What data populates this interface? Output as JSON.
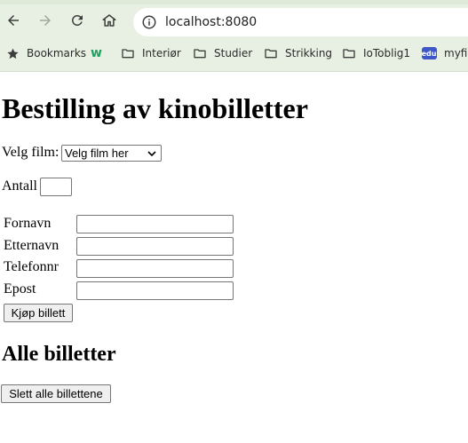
{
  "browser": {
    "url": "localhost:8080",
    "bookmarks": [
      {
        "label": "Bookmarks",
        "icon": "star-icon"
      },
      {
        "label": "",
        "icon": "w-logo-icon"
      },
      {
        "label": "Interiør",
        "icon": "folder-icon"
      },
      {
        "label": "Studier",
        "icon": "folder-icon"
      },
      {
        "label": "Strikking",
        "icon": "folder-icon"
      },
      {
        "label": "IoToblig1",
        "icon": "folder-icon"
      },
      {
        "label": "myfirs",
        "icon": "edu-icon"
      }
    ],
    "w_logo_text": "w",
    "edu_badge_text": "edu"
  },
  "page": {
    "title": "Bestilling av kinobilletter",
    "film_label": "Velg film:",
    "film_select_value": "Velg film her",
    "antall_label": "Antall",
    "antall_value": "",
    "form": {
      "fornavn_label": "Fornavn",
      "etternavn_label": "Etternavn",
      "telefonnr_label": "Telefonnr",
      "epost_label": "Epost",
      "fornavn_value": "",
      "etternavn_value": "",
      "telefonnr_value": "",
      "epost_value": ""
    },
    "buy_button": "Kjøp billett",
    "all_tickets_heading": "Alle billetter",
    "delete_all_button": "Slett alle billettene"
  },
  "colors": {
    "chrome_background": "#e8f0e3",
    "button_background": "#efefef",
    "input_border": "#767676"
  }
}
